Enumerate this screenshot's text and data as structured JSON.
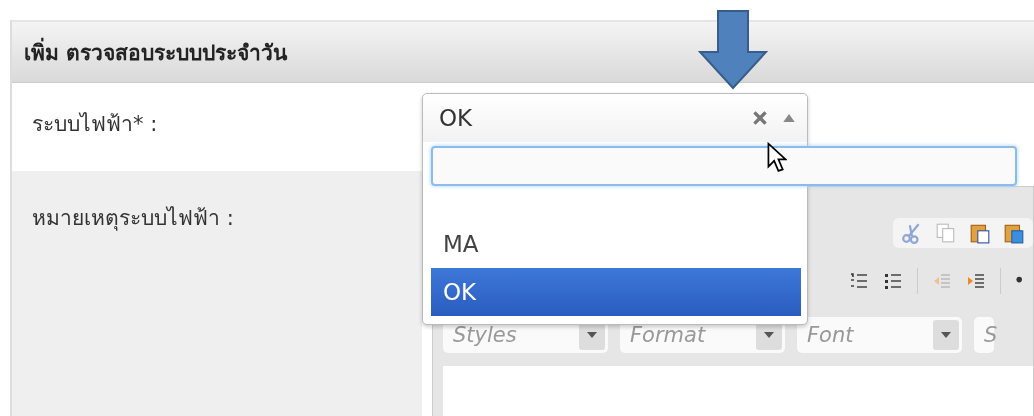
{
  "window": {
    "title": "เพิ่ม ตรวจสอบระบบประจำวัน"
  },
  "fields": [
    {
      "label": "ระบบไฟฟ้า* :",
      "kind": "select"
    },
    {
      "label": "หมายเหตุระบบไฟฟ้า :",
      "kind": "editor"
    }
  ],
  "select": {
    "value": "OK",
    "expanded": true,
    "options": [
      {
        "label": "MA",
        "selected": false
      },
      {
        "label": "OK",
        "selected": true
      }
    ]
  },
  "editor": {
    "combos": [
      "Styles",
      "Format",
      "Font",
      "S"
    ]
  }
}
